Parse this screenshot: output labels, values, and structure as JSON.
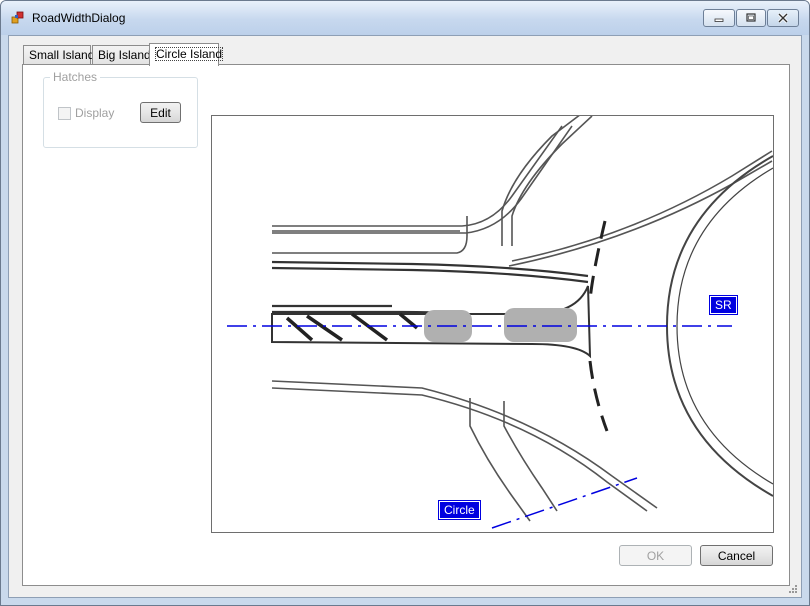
{
  "window": {
    "title": "RoadWidthDialog"
  },
  "tabs": [
    {
      "label": "Small Island",
      "active": false
    },
    {
      "label": "Big Island",
      "active": false
    },
    {
      "label": "Circle Island",
      "active": true
    }
  ],
  "hatches": {
    "group_label": "Hatches",
    "display_label": "Display",
    "display_checked": false,
    "edit_label": "Edit"
  },
  "picture": {
    "sr_label": "SR",
    "circle_label": "Circle"
  },
  "footer": {
    "ok_label": "OK",
    "cancel_label": "Cancel"
  },
  "colors": {
    "accent_blue": "#0000e0",
    "window_frame": "#c9d9ec"
  }
}
